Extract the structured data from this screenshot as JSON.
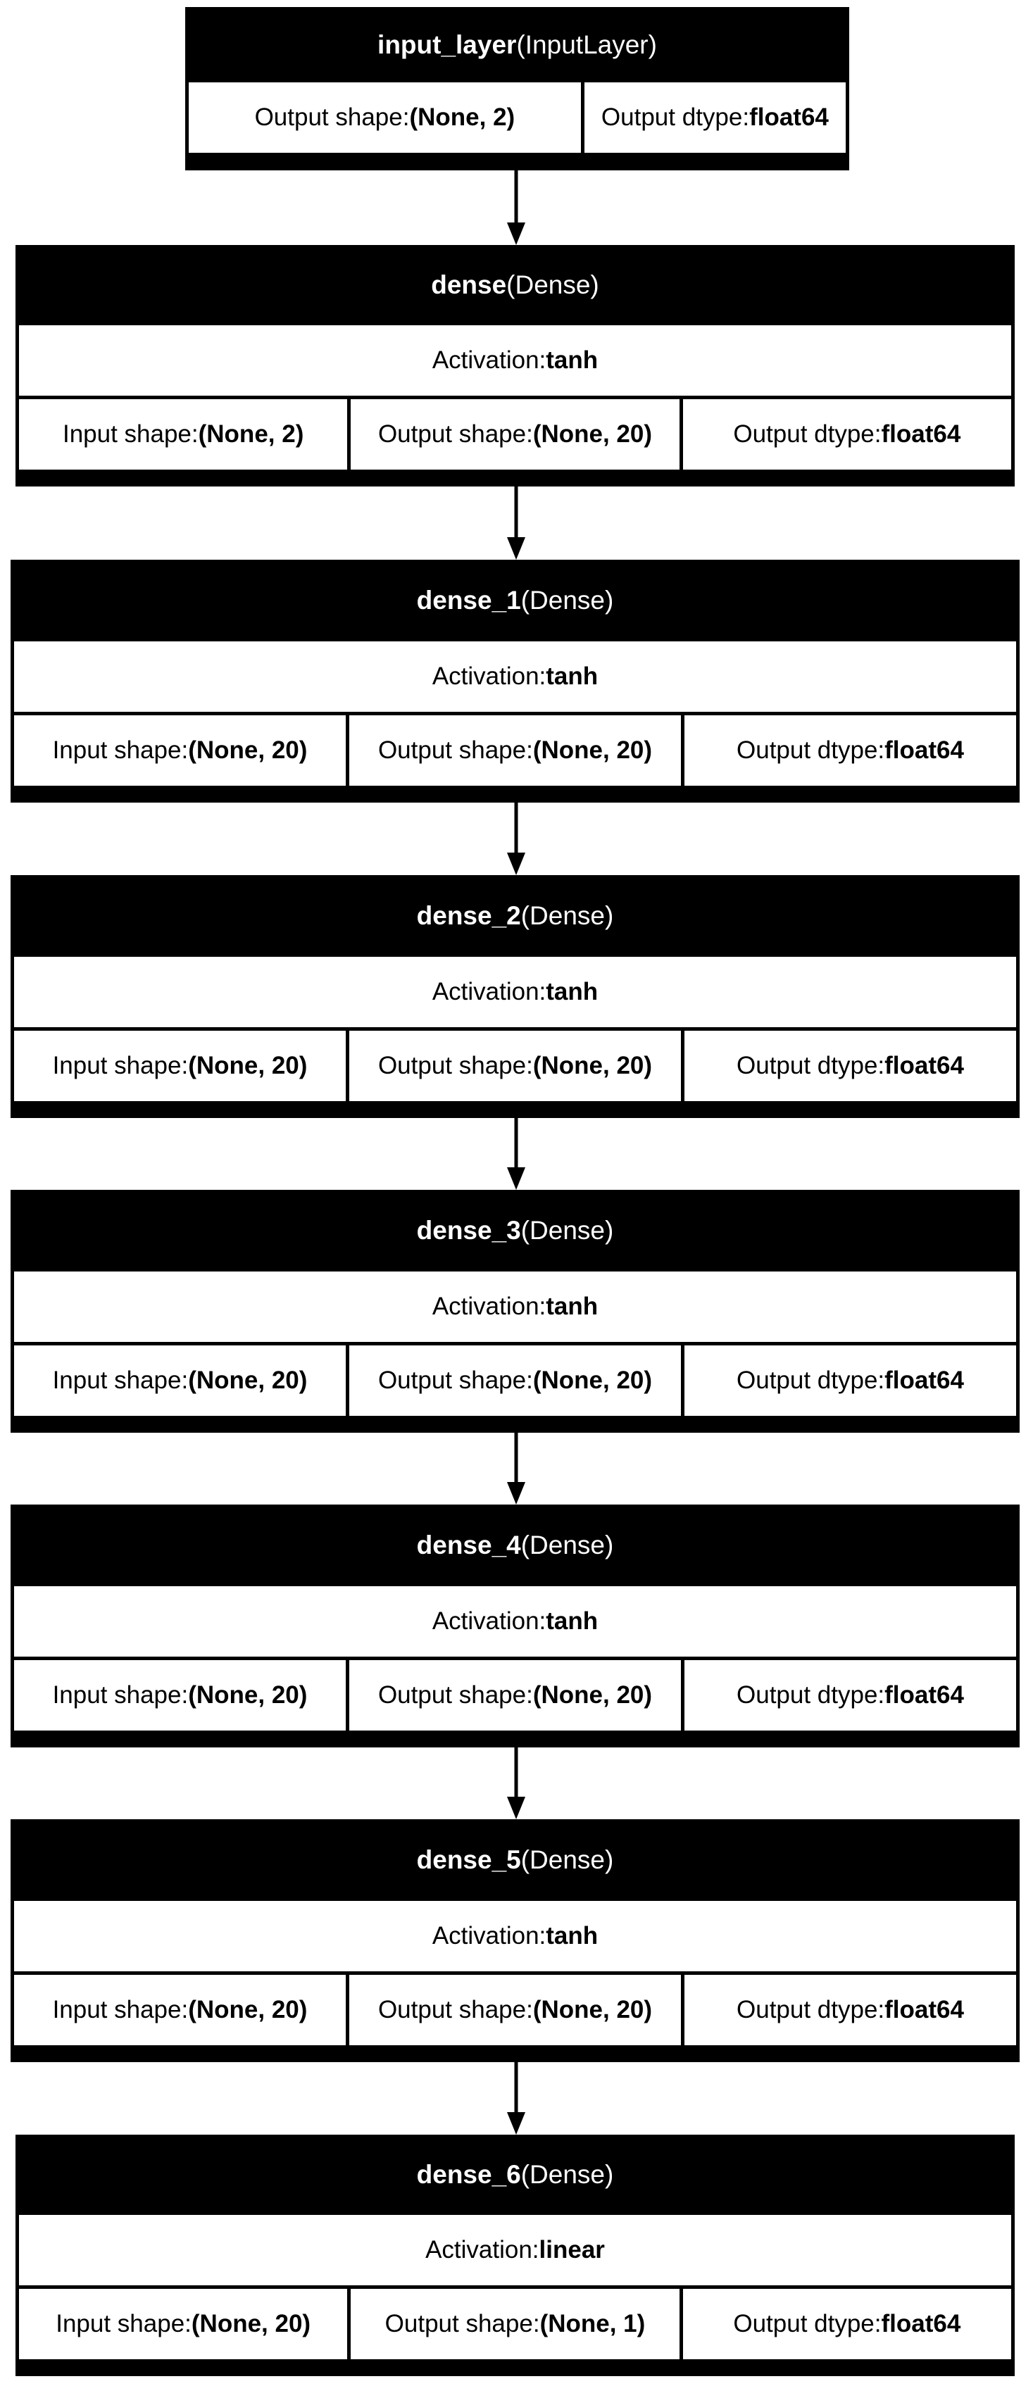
{
  "nodes": [
    {
      "name": "input_layer",
      "type": "(InputLayer)",
      "activation": null,
      "cells": [
        {
          "label": "Output shape: ",
          "value": "(None, 2)"
        },
        {
          "label": "Output dtype: ",
          "value": "float64"
        }
      ]
    },
    {
      "name": "dense",
      "type": "(Dense)",
      "activation": {
        "label": "Activation: ",
        "value": "tanh"
      },
      "cells": [
        {
          "label": "Input shape: ",
          "value": "(None, 2)"
        },
        {
          "label": "Output shape: ",
          "value": "(None, 20)"
        },
        {
          "label": "Output dtype: ",
          "value": "float64"
        }
      ]
    },
    {
      "name": "dense_1",
      "type": "(Dense)",
      "activation": {
        "label": "Activation: ",
        "value": "tanh"
      },
      "cells": [
        {
          "label": "Input shape: ",
          "value": "(None, 20)"
        },
        {
          "label": "Output shape: ",
          "value": "(None, 20)"
        },
        {
          "label": "Output dtype: ",
          "value": "float64"
        }
      ]
    },
    {
      "name": "dense_2",
      "type": "(Dense)",
      "activation": {
        "label": "Activation: ",
        "value": "tanh"
      },
      "cells": [
        {
          "label": "Input shape: ",
          "value": "(None, 20)"
        },
        {
          "label": "Output shape: ",
          "value": "(None, 20)"
        },
        {
          "label": "Output dtype: ",
          "value": "float64"
        }
      ]
    },
    {
      "name": "dense_3",
      "type": "(Dense)",
      "activation": {
        "label": "Activation: ",
        "value": "tanh"
      },
      "cells": [
        {
          "label": "Input shape: ",
          "value": "(None, 20)"
        },
        {
          "label": "Output shape: ",
          "value": "(None, 20)"
        },
        {
          "label": "Output dtype: ",
          "value": "float64"
        }
      ]
    },
    {
      "name": "dense_4",
      "type": "(Dense)",
      "activation": {
        "label": "Activation: ",
        "value": "tanh"
      },
      "cells": [
        {
          "label": "Input shape: ",
          "value": "(None, 20)"
        },
        {
          "label": "Output shape: ",
          "value": "(None, 20)"
        },
        {
          "label": "Output dtype: ",
          "value": "float64"
        }
      ]
    },
    {
      "name": "dense_5",
      "type": "(Dense)",
      "activation": {
        "label": "Activation: ",
        "value": "tanh"
      },
      "cells": [
        {
          "label": "Input shape: ",
          "value": "(None, 20)"
        },
        {
          "label": "Output shape: ",
          "value": "(None, 20)"
        },
        {
          "label": "Output dtype: ",
          "value": "float64"
        }
      ]
    },
    {
      "name": "dense_6",
      "type": "(Dense)",
      "activation": {
        "label": "Activation: ",
        "value": "linear"
      },
      "cells": [
        {
          "label": "Input shape: ",
          "value": "(None, 20)"
        },
        {
          "label": "Output shape: ",
          "value": "(None, 1)"
        },
        {
          "label": "Output dtype: ",
          "value": "float64"
        }
      ]
    }
  ]
}
